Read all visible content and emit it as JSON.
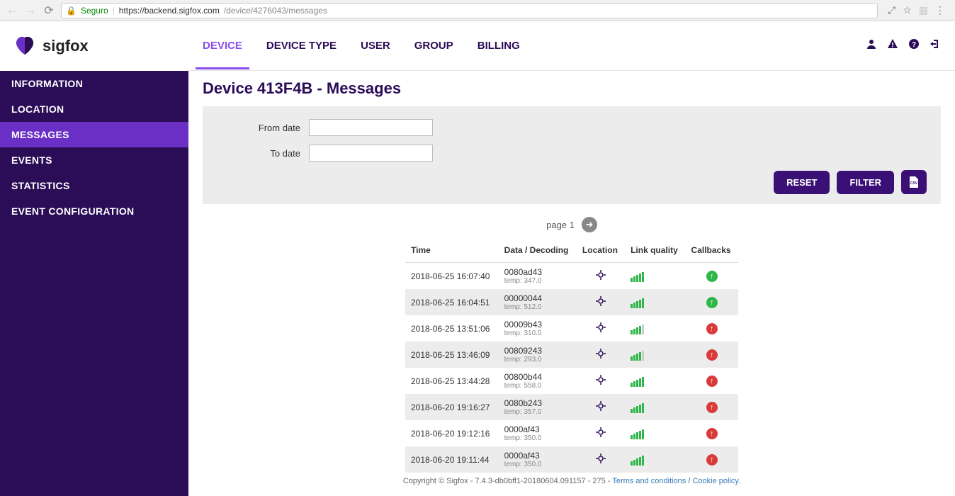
{
  "browser": {
    "secure_label": "Seguro",
    "url_host": "https://backend.sigfox.com",
    "url_path": "/device/4276043/messages"
  },
  "brand": {
    "name": "sigfox"
  },
  "topnav": {
    "tabs": [
      "DEVICE",
      "DEVICE TYPE",
      "USER",
      "GROUP",
      "BILLING"
    ],
    "active": 0
  },
  "sidebar": {
    "items": [
      "INFORMATION",
      "LOCATION",
      "MESSAGES",
      "EVENTS",
      "STATISTICS",
      "EVENT CONFIGURATION"
    ],
    "active": 2
  },
  "page": {
    "title": "Device 413F4B - Messages"
  },
  "filter": {
    "from_label": "From date",
    "to_label": "To date",
    "from_value": "",
    "to_value": "",
    "reset_label": "RESET",
    "filter_label": "FILTER"
  },
  "pager": {
    "label": "page 1"
  },
  "table": {
    "headers": [
      "Time",
      "Data / Decoding",
      "Location",
      "Link quality",
      "Callbacks"
    ],
    "rows": [
      {
        "time": "2018-06-25 16:07:40",
        "hex": "0080ad43",
        "decoded": "temp: 347.0",
        "signal": 5,
        "callback": "ok"
      },
      {
        "time": "2018-06-25 16:04:51",
        "hex": "00000044",
        "decoded": "temp: 512.0",
        "signal": 5,
        "callback": "ok"
      },
      {
        "time": "2018-06-25 13:51:06",
        "hex": "00009b43",
        "decoded": "temp: 310.0",
        "signal": 4,
        "callback": "err"
      },
      {
        "time": "2018-06-25 13:46:09",
        "hex": "00809243",
        "decoded": "temp: 293.0",
        "signal": 4,
        "callback": "err"
      },
      {
        "time": "2018-06-25 13:44:28",
        "hex": "00800b44",
        "decoded": "temp: 558.0",
        "signal": 5,
        "callback": "err"
      },
      {
        "time": "2018-06-20 19:16:27",
        "hex": "0080b243",
        "decoded": "temp: 357.0",
        "signal": 5,
        "callback": "err"
      },
      {
        "time": "2018-06-20 19:12:16",
        "hex": "0000af43",
        "decoded": "temp: 350.0",
        "signal": 5,
        "callback": "err"
      },
      {
        "time": "2018-06-20 19:11:44",
        "hex": "0000af43",
        "decoded": "temp: 350.0",
        "signal": 5,
        "callback": "err"
      }
    ]
  },
  "footer": {
    "text": "Copyright © Sigfox - 7.4.3-db0bff1-20180604.091157 - 275 - ",
    "terms": "Terms and conditions",
    "sep": " / ",
    "cookie": "Cookie policy",
    "end": "."
  }
}
